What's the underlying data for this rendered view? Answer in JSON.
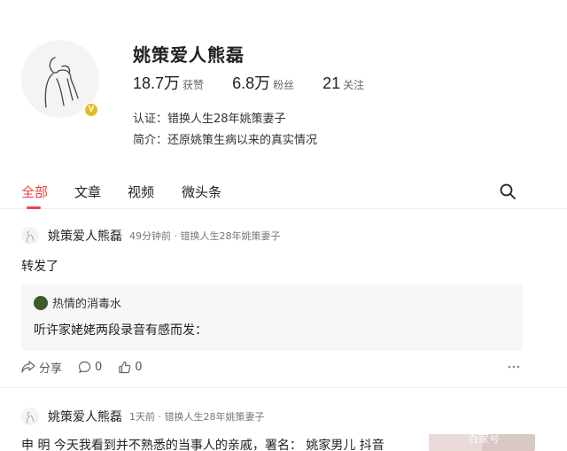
{
  "profile": {
    "name": "姚策爱人熊磊",
    "stats": [
      {
        "value": "18.7万",
        "label": "获赞"
      },
      {
        "value": "6.8万",
        "label": "粉丝"
      },
      {
        "value": "21",
        "label": "关注"
      }
    ],
    "verification": "认证：错换人生28年姚策妻子",
    "bio": "简介：还原姚策生病以来的真实情况",
    "badge": "V"
  },
  "tabs": [
    {
      "label": "全部",
      "active": true
    },
    {
      "label": "文章",
      "active": false
    },
    {
      "label": "视频",
      "active": false
    },
    {
      "label": "微头条",
      "active": false
    }
  ],
  "posts": [
    {
      "author": "姚策爱人熊磊",
      "meta": "49分钟前 · 错换人生28年姚策妻子",
      "text": "转发了",
      "quote": {
        "author": "热情的消毒水",
        "text": "听许家姥姥两段录音有感而发："
      },
      "actions": {
        "share": "分享",
        "comments": "0",
        "likes": "0"
      }
    },
    {
      "author": "姚策爱人熊磊",
      "meta": "1天前 · 错换人生28年姚策妻子",
      "text": "申 明 今天我看到并不熟悉的当事人的亲戚，署名：  姚家男儿  抖音"
    }
  ],
  "watermark": "百家号",
  "colors": {
    "accent": "#f04142",
    "badge": "#e8b923"
  },
  "icons": {
    "search": "search-icon",
    "share": "share-icon",
    "comment": "comment-icon",
    "like": "thumbs-up-icon",
    "more": "more-icon"
  }
}
